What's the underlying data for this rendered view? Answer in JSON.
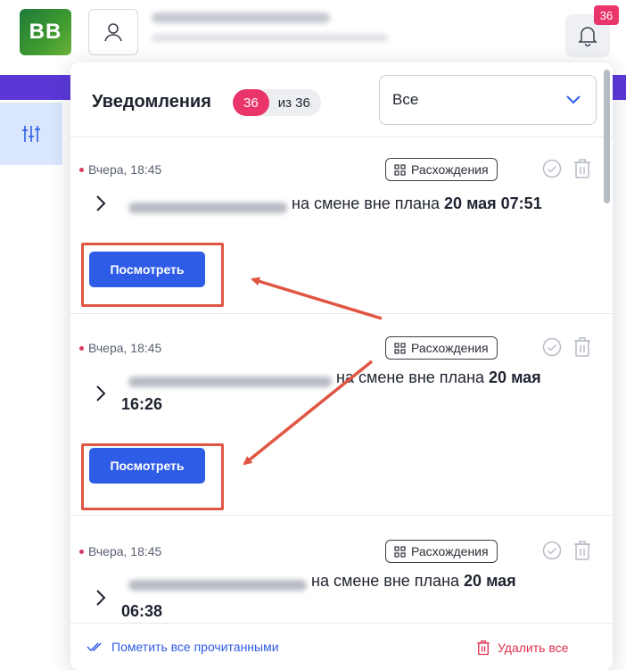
{
  "app": {
    "logo_text": "BB",
    "notification_badge": "36",
    "colors": {
      "accent": "#2f5ce6",
      "brand": "#3f9b2f",
      "badge": "#e9356a",
      "topbar": "#5b38d6",
      "annotation": "#e05543"
    }
  },
  "panel": {
    "title": "Уведомления",
    "unread_count": "36",
    "total_label": "из 36",
    "filter": {
      "selected": "Все"
    }
  },
  "notifications": [
    {
      "time": "Вчера, 18:45",
      "tag": "Расхождения",
      "text_mid": "на смене вне плана",
      "text_bold": "20 мая 07:51",
      "button": "Посмотреть"
    },
    {
      "time": "Вчера, 18:45",
      "tag": "Расхождения",
      "text_mid": "на смене вне плана",
      "text_bold_1": "20 мая",
      "text_bold_2": "16:26",
      "button": "Посмотреть"
    },
    {
      "time": "Вчера, 18:45",
      "tag": "Расхождения",
      "text_mid": "на смене вне плана",
      "text_bold_1": "20 мая",
      "text_bold_2": "06:38"
    }
  ],
  "footer": {
    "mark_all_read": "Пометить все прочитанными",
    "delete_all": "Удалить все"
  },
  "icons": [
    "user-icon",
    "bell-icon",
    "filter-sliders-icon",
    "chevron-down-icon",
    "grid-icon",
    "check-circle-icon",
    "trash-icon",
    "chevron-right-icon",
    "double-check-icon"
  ]
}
